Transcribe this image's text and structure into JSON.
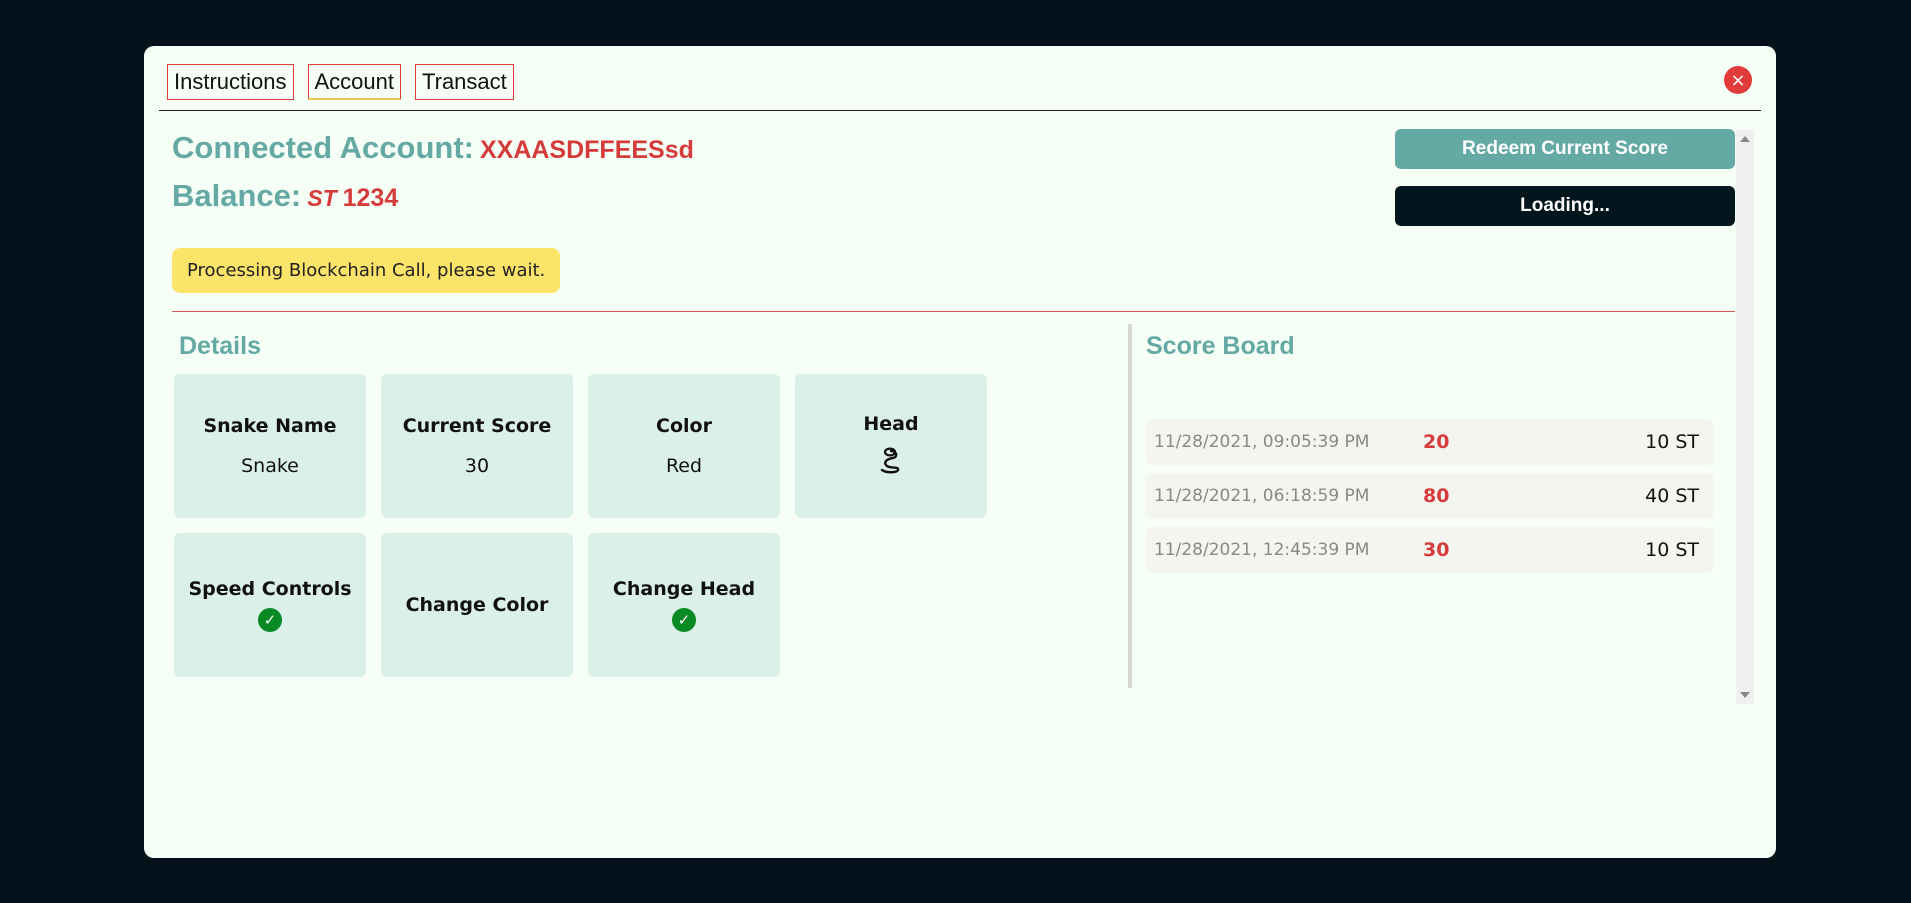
{
  "tabs": [
    {
      "label": "Instructions"
    },
    {
      "label": "Account"
    },
    {
      "label": "Transact"
    }
  ],
  "close_icon": "×",
  "account": {
    "connected_label": "Connected Account:",
    "connected_value": "XXAASDFFEESsd",
    "balance_label": "Balance:",
    "balance_symbol": "ST",
    "balance_value": "1234"
  },
  "buttons": {
    "redeem": "Redeem Current Score",
    "loading": "Loading..."
  },
  "status_message": "Processing Blockchain Call, please wait.",
  "details": {
    "title": "Details",
    "cards": [
      {
        "title": "Snake Name",
        "value": "Snake"
      },
      {
        "title": "Current Score",
        "value": "30"
      },
      {
        "title": "Color",
        "value": "Red"
      },
      {
        "title": "Head",
        "icon": "snake-icon"
      }
    ],
    "features": [
      {
        "title": "Speed Controls",
        "enabled": true
      },
      {
        "title": "Change Color",
        "enabled": false
      },
      {
        "title": "Change Head",
        "enabled": true
      }
    ]
  },
  "scoreboard": {
    "title": "Score Board",
    "rows": [
      {
        "time": "11/28/2021, 09:05:39 PM",
        "score": "20",
        "reward": "10 ST"
      },
      {
        "time": "11/28/2021, 06:18:59 PM",
        "score": "80",
        "reward": "40 ST"
      },
      {
        "time": "11/28/2021, 12:45:39 PM",
        "score": "30",
        "reward": "10 ST"
      }
    ]
  },
  "colors": {
    "accent": "#65a9a5",
    "danger": "#d63b3b",
    "warning": "#fce36a",
    "success": "#0a8a25"
  }
}
